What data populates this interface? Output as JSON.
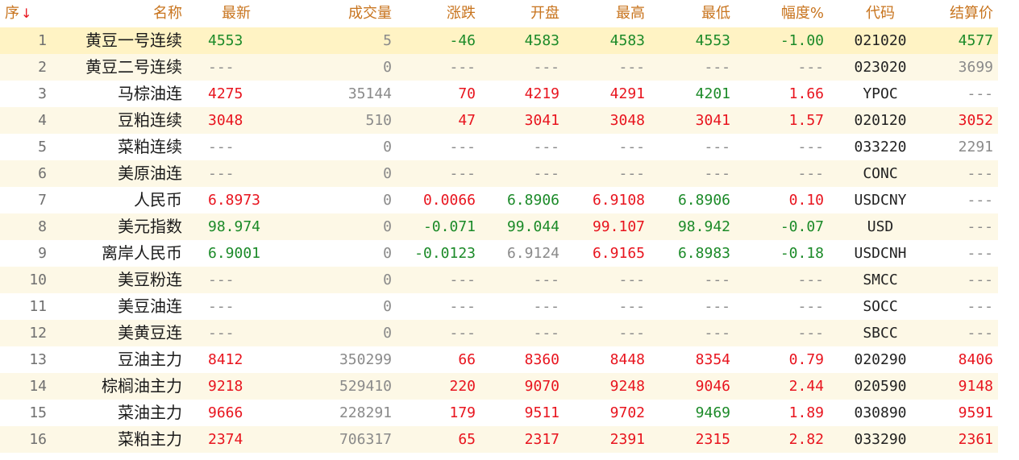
{
  "headers": {
    "seq": "序",
    "name": "名称",
    "last": "最新",
    "volume": "成交量",
    "change": "涨跌",
    "open": "开盘",
    "high": "最高",
    "low": "最低",
    "pct": "幅度%",
    "code": "代码",
    "settle": "结算价",
    "sort_icon": "sort-desc-arrow-icon"
  },
  "colors": {
    "up": "#e8141e",
    "down": "#1b8a28",
    "flat": "#8a8a8a",
    "header": "#c8741e",
    "selected_row": "#fff3c4"
  },
  "rows": [
    {
      "seq": "1",
      "name": "黄豆一号连续",
      "last": "4553",
      "volume": "5",
      "change": "-46",
      "open": "4583",
      "high": "4583",
      "low": "4553",
      "pct": "-1.00",
      "code": "021020",
      "settle": "4577",
      "cls": {
        "last": "green",
        "volume": "gray",
        "change": "green",
        "open": "green",
        "high": "green",
        "low": "green",
        "pct": "green",
        "settle": "green"
      }
    },
    {
      "seq": "2",
      "name": "黄豆二号连续",
      "last": "---",
      "volume": "0",
      "change": "---",
      "open": "---",
      "high": "---",
      "low": "---",
      "pct": "---",
      "code": "023020",
      "settle": "3699",
      "cls": {
        "last": "gray",
        "volume": "gray",
        "change": "gray",
        "open": "gray",
        "high": "gray",
        "low": "gray",
        "pct": "gray",
        "settle": "gray"
      }
    },
    {
      "seq": "3",
      "name": "马棕油连",
      "last": "4275",
      "volume": "35144",
      "change": "70",
      "open": "4219",
      "high": "4291",
      "low": "4201",
      "pct": "1.66",
      "code": "YPOC",
      "settle": "---",
      "cls": {
        "last": "red",
        "volume": "gray",
        "change": "red",
        "open": "red",
        "high": "red",
        "low": "green",
        "pct": "red",
        "settle": "gray"
      }
    },
    {
      "seq": "4",
      "name": "豆粕连续",
      "last": "3048",
      "volume": "510",
      "change": "47",
      "open": "3041",
      "high": "3048",
      "low": "3041",
      "pct": "1.57",
      "code": "020120",
      "settle": "3052",
      "cls": {
        "last": "red",
        "volume": "gray",
        "change": "red",
        "open": "red",
        "high": "red",
        "low": "red",
        "pct": "red",
        "settle": "red"
      }
    },
    {
      "seq": "5",
      "name": "菜粕连续",
      "last": "---",
      "volume": "0",
      "change": "---",
      "open": "---",
      "high": "---",
      "low": "---",
      "pct": "---",
      "code": "033220",
      "settle": "2291",
      "cls": {
        "last": "gray",
        "volume": "gray",
        "change": "gray",
        "open": "gray",
        "high": "gray",
        "low": "gray",
        "pct": "gray",
        "settle": "gray"
      }
    },
    {
      "seq": "6",
      "name": "美原油连",
      "last": "---",
      "volume": "0",
      "change": "---",
      "open": "---",
      "high": "---",
      "low": "---",
      "pct": "---",
      "code": "CONC",
      "settle": "---",
      "cls": {
        "last": "gray",
        "volume": "gray",
        "change": "gray",
        "open": "gray",
        "high": "gray",
        "low": "gray",
        "pct": "gray",
        "settle": "gray"
      }
    },
    {
      "seq": "7",
      "name": "人民币",
      "last": "6.8973",
      "volume": "0",
      "change": "0.0066",
      "open": "6.8906",
      "high": "6.9108",
      "low": "6.8906",
      "pct": "0.10",
      "code": "USDCNY",
      "settle": "---",
      "cls": {
        "last": "red",
        "volume": "gray",
        "change": "red",
        "open": "green",
        "high": "red",
        "low": "green",
        "pct": "red",
        "settle": "gray"
      }
    },
    {
      "seq": "8",
      "name": "美元指数",
      "last": "98.974",
      "volume": "0",
      "change": "-0.071",
      "open": "99.044",
      "high": "99.107",
      "low": "98.942",
      "pct": "-0.07",
      "code": "USD",
      "settle": "---",
      "cls": {
        "last": "green",
        "volume": "gray",
        "change": "green",
        "open": "green",
        "high": "red",
        "low": "green",
        "pct": "green",
        "settle": "gray"
      }
    },
    {
      "seq": "9",
      "name": "离岸人民币",
      "last": "6.9001",
      "volume": "0",
      "change": "-0.0123",
      "open": "6.9124",
      "high": "6.9165",
      "low": "6.8983",
      "pct": "-0.18",
      "code": "USDCNH",
      "settle": "---",
      "cls": {
        "last": "green",
        "volume": "gray",
        "change": "green",
        "open": "gray",
        "high": "red",
        "low": "green",
        "pct": "green",
        "settle": "gray"
      }
    },
    {
      "seq": "10",
      "name": "美豆粉连",
      "last": "---",
      "volume": "0",
      "change": "---",
      "open": "---",
      "high": "---",
      "low": "---",
      "pct": "---",
      "code": "SMCC",
      "settle": "---",
      "cls": {
        "last": "gray",
        "volume": "gray",
        "change": "gray",
        "open": "gray",
        "high": "gray",
        "low": "gray",
        "pct": "gray",
        "settle": "gray"
      }
    },
    {
      "seq": "11",
      "name": "美豆油连",
      "last": "---",
      "volume": "0",
      "change": "---",
      "open": "---",
      "high": "---",
      "low": "---",
      "pct": "---",
      "code": "SOCC",
      "settle": "---",
      "cls": {
        "last": "gray",
        "volume": "gray",
        "change": "gray",
        "open": "gray",
        "high": "gray",
        "low": "gray",
        "pct": "gray",
        "settle": "gray"
      }
    },
    {
      "seq": "12",
      "name": "美黄豆连",
      "last": "---",
      "volume": "0",
      "change": "---",
      "open": "---",
      "high": "---",
      "low": "---",
      "pct": "---",
      "code": "SBCC",
      "settle": "---",
      "cls": {
        "last": "gray",
        "volume": "gray",
        "change": "gray",
        "open": "gray",
        "high": "gray",
        "low": "gray",
        "pct": "gray",
        "settle": "gray"
      }
    },
    {
      "seq": "13",
      "name": "豆油主力",
      "last": "8412",
      "volume": "350299",
      "change": "66",
      "open": "8360",
      "high": "8448",
      "low": "8354",
      "pct": "0.79",
      "code": "020290",
      "settle": "8406",
      "cls": {
        "last": "red",
        "volume": "gray",
        "change": "red",
        "open": "red",
        "high": "red",
        "low": "red",
        "pct": "red",
        "settle": "red"
      }
    },
    {
      "seq": "14",
      "name": "棕榈油主力",
      "last": "9218",
      "volume": "529410",
      "change": "220",
      "open": "9070",
      "high": "9248",
      "low": "9046",
      "pct": "2.44",
      "code": "020590",
      "settle": "9148",
      "cls": {
        "last": "red",
        "volume": "gray",
        "change": "red",
        "open": "red",
        "high": "red",
        "low": "red",
        "pct": "red",
        "settle": "red"
      }
    },
    {
      "seq": "15",
      "name": "菜油主力",
      "last": "9666",
      "volume": "228291",
      "change": "179",
      "open": "9511",
      "high": "9702",
      "low": "9469",
      "pct": "1.89",
      "code": "030890",
      "settle": "9591",
      "cls": {
        "last": "red",
        "volume": "gray",
        "change": "red",
        "open": "red",
        "high": "red",
        "low": "green",
        "pct": "red",
        "settle": "red"
      }
    },
    {
      "seq": "16",
      "name": "菜粕主力",
      "last": "2374",
      "volume": "706317",
      "change": "65",
      "open": "2317",
      "high": "2391",
      "low": "2315",
      "pct": "2.82",
      "code": "033290",
      "settle": "2361",
      "cls": {
        "last": "red",
        "volume": "gray",
        "change": "red",
        "open": "red",
        "high": "red",
        "low": "red",
        "pct": "red",
        "settle": "red"
      }
    }
  ]
}
